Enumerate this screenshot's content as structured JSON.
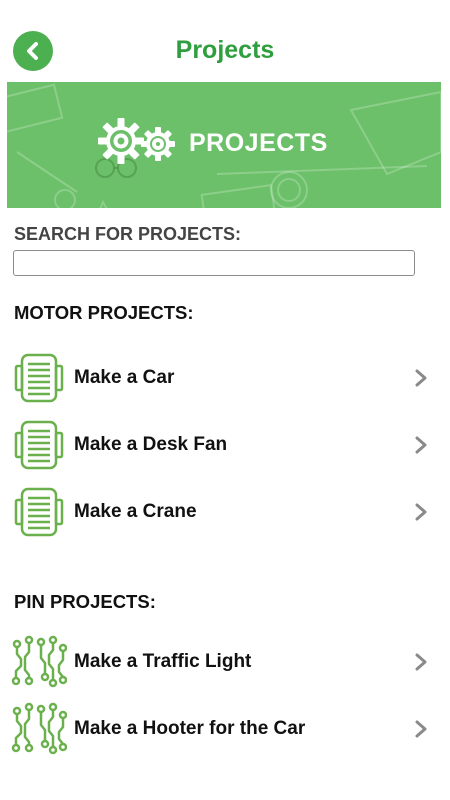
{
  "header": {
    "title": "Projects",
    "back_icon": "back-arrow-icon"
  },
  "banner": {
    "title": "PROJECTS",
    "icon": "gears-icon"
  },
  "search": {
    "label": "SEARCH FOR PROJECTS:",
    "value": "",
    "placeholder": ""
  },
  "motor_projects": {
    "heading": "MOTOR PROJECTS:",
    "icon": "motor-icon",
    "items": [
      {
        "label": "Make a Car"
      },
      {
        "label": "Make a Desk Fan"
      },
      {
        "label": "Make a Crane"
      }
    ]
  },
  "pin_projects": {
    "heading": "PIN PROJECTS:",
    "icon": "circuit-pins-icon",
    "items": [
      {
        "label": "Make a Traffic Light"
      },
      {
        "label": "Make a Hooter for the Car"
      }
    ]
  },
  "colors": {
    "accent": "#4caf50",
    "title_green": "#2e9e3e",
    "banner_green": "#6cc06a",
    "icon_green": "#6ab04c",
    "chevron": "#8a8a8a"
  }
}
